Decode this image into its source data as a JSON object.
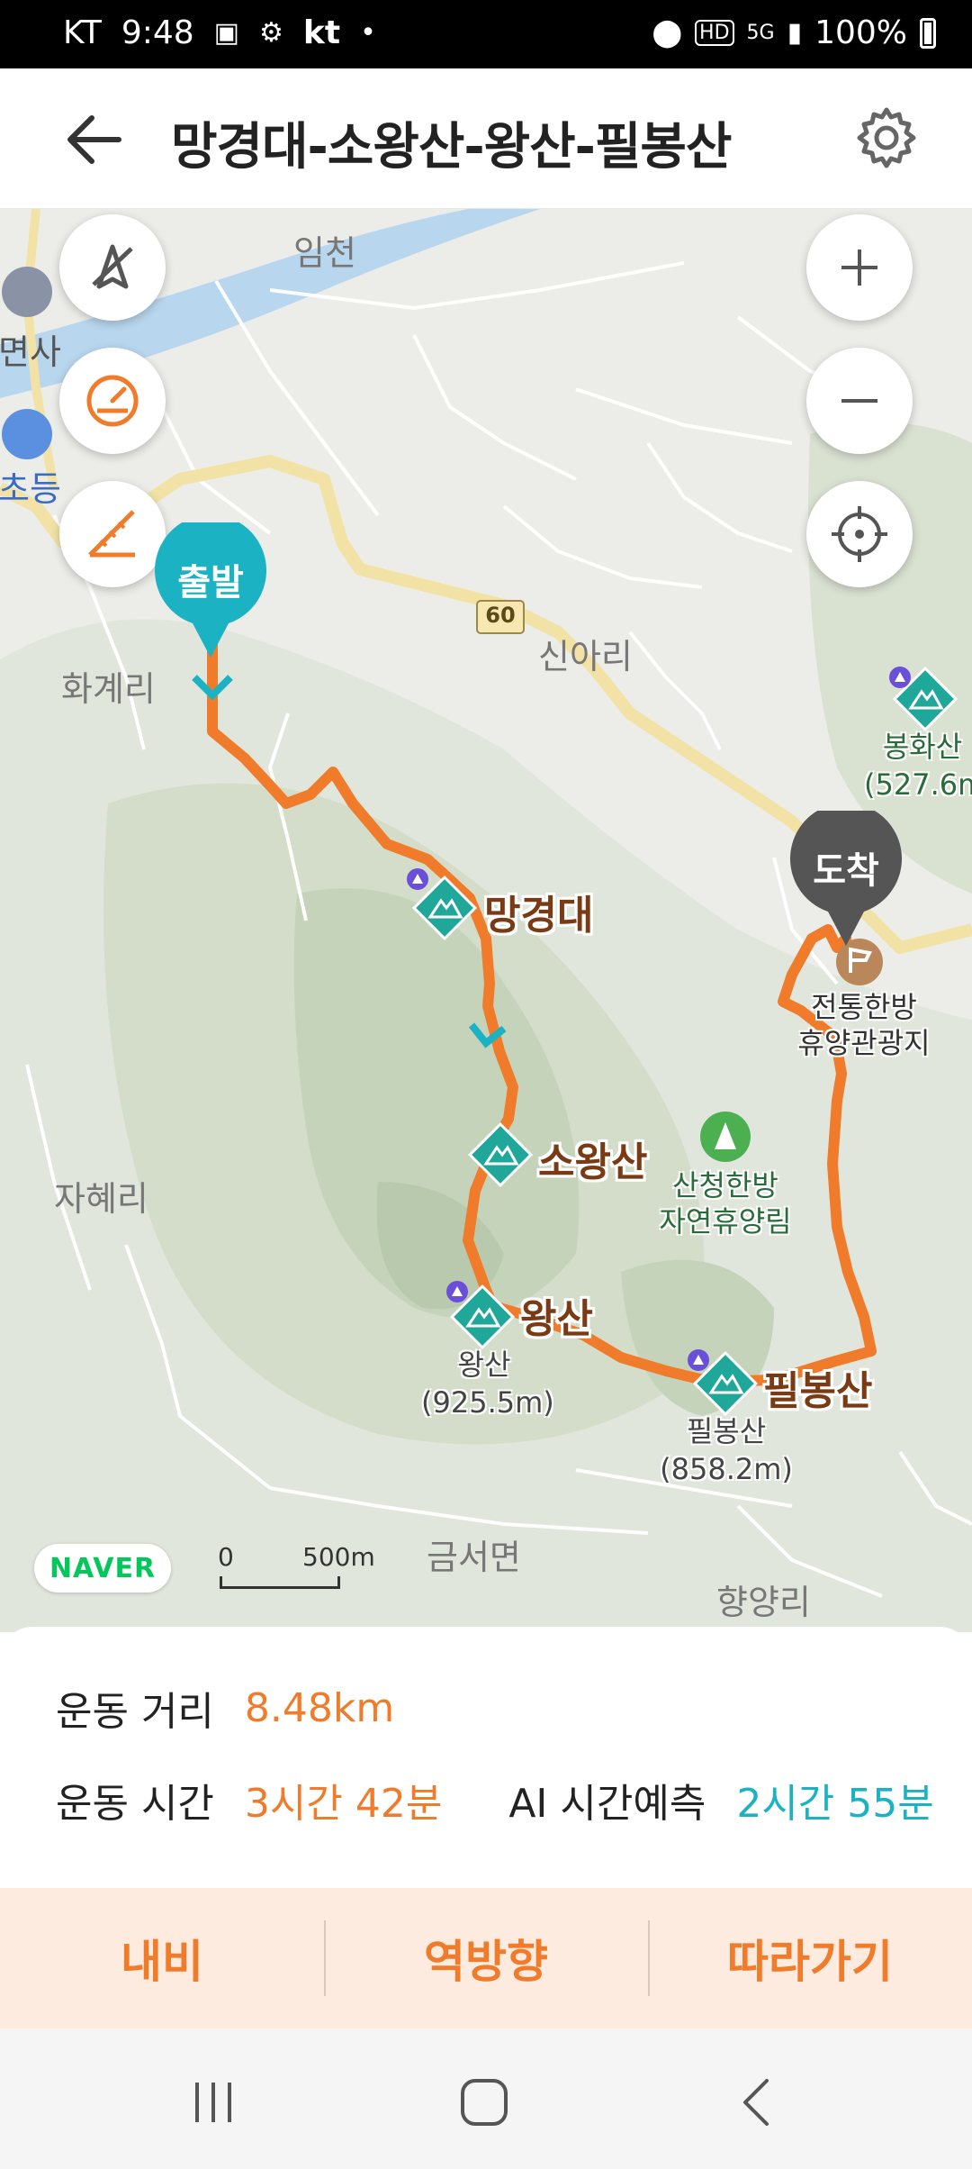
{
  "status_bar": {
    "carrier": "KT",
    "time": "9:48",
    "carrier_logo": "kt",
    "battery": "100%",
    "icons": [
      "gallery-icon",
      "step-icon",
      "location-icon",
      "hd-icon",
      "5g-icon",
      "signal-icon",
      "battery-icon"
    ]
  },
  "header": {
    "title": "망경대-소왕산-왕산-필봉산"
  },
  "map": {
    "place_labels": {
      "imcheon": "임천",
      "myeonsa": "면사",
      "chodeung": "초등",
      "hwagyeri": "화계리",
      "sinari": "신아리",
      "jahyeri": "자혜리",
      "geumseomyeon": "금서면",
      "hyangyangri": "향양리",
      "road_number": "60"
    },
    "start_pin": "출발",
    "end_pin": "도착",
    "peaks": {
      "manggyeongdae": "망경대",
      "sowangsan": "소왕산",
      "wangsan": "왕산",
      "wangsan_sub_name": "왕산",
      "wangsan_sub_height": "(925.5m)",
      "pilbongsan": "필봉산",
      "pilbongsan_sub_name": "필봉산",
      "pilbongsan_sub_height": "(858.2m)",
      "bonghwasan_name": "봉화산",
      "bonghwasan_height": "(527.6m"
    },
    "pois": {
      "resort_line1": "전통한방",
      "resort_line2": "휴양관광지",
      "forest_line1": "산청한방",
      "forest_line2": "자연휴양림"
    },
    "naver_logo": "NAVER",
    "scale": {
      "start": "0",
      "end": "500m"
    }
  },
  "info": {
    "distance_label": "운동 거리",
    "distance_value": "8.48km",
    "time_label": "운동 시간",
    "time_value": "3시간 42분",
    "ai_label": "AI 시간예측",
    "ai_value": "2시간 55분"
  },
  "actions": {
    "navi": "내비",
    "reverse": "역방향",
    "follow": "따라가기"
  },
  "colors": {
    "route": "#f07b2a",
    "start_pin": "#1bb3c4",
    "end_pin": "#555555",
    "peak_icon": "#1fa79a",
    "accent_orange": "#f07b2a",
    "accent_teal": "#1bb3c4"
  }
}
